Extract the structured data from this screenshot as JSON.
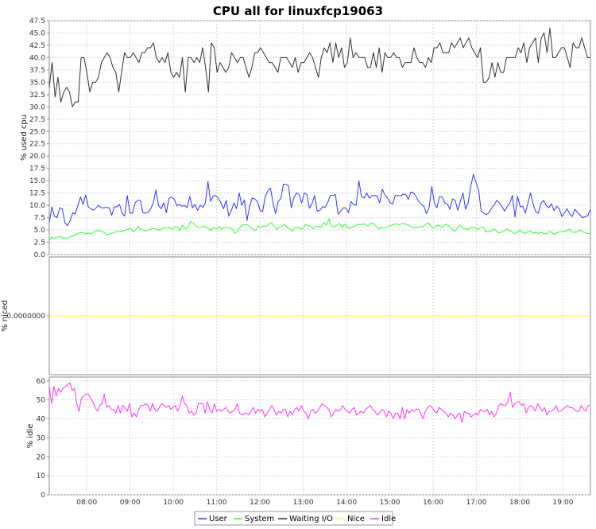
{
  "chart_data": {
    "type": "line",
    "title": "CPU all for linuxfcp19063",
    "x_tick_labels": [
      "08:00",
      "09:00",
      "10:00",
      "11:00",
      "12:00",
      "13:00",
      "14:00",
      "15:00",
      "16:00",
      "17:00",
      "18:00",
      "19:00"
    ],
    "x_range": [
      "07:08",
      "19:38"
    ],
    "grid": true,
    "legend_position": "bottom",
    "legend": [
      "User",
      "System",
      "Waiting I/O",
      "Nice",
      "Idle"
    ],
    "colors": {
      "User": "#3333ff",
      "System": "#33ff33",
      "Waiting I/O": "#333333",
      "Nice": "#ffff33",
      "Idle": "#ff33ff"
    },
    "panels": [
      {
        "ylabel": "% used cpu",
        "ylim": [
          0,
          47.5
        ],
        "y_ticks": [
          "0.0",
          "2.5",
          "5.0",
          "7.5",
          "10.0",
          "12.5",
          "15.0",
          "17.5",
          "20.0",
          "22.5",
          "25.0",
          "27.5",
          "30.0",
          "32.5",
          "35.0",
          "37.5",
          "40.0",
          "42.5",
          "45.0",
          "47.5"
        ],
        "series": [
          {
            "name": "Waiting I/O",
            "values": [
              34,
              39,
              32,
              36,
              31,
              33,
              34,
              33,
              30,
              31,
              31,
              40,
              40,
              37,
              33,
              35,
              35,
              36,
              39,
              40,
              41,
              40,
              38,
              37,
              33,
              37,
              41,
              40,
              40,
              41,
              40,
              39,
              41,
              41,
              42,
              42,
              43,
              40,
              39,
              40,
              39,
              41,
              37,
              36,
              37,
              36,
              40,
              33,
              40,
              40,
              39,
              40,
              39,
              42,
              38,
              33,
              43,
              42,
              37,
              39,
              38,
              37,
              38,
              41,
              40,
              39,
              40,
              40,
              38,
              36,
              38,
              41,
              41,
              42,
              41,
              40,
              39,
              39,
              38,
              37,
              40,
              40,
              40,
              39,
              38,
              40,
              37,
              39,
              39,
              40,
              41,
              40,
              38,
              36,
              40,
              42,
              41,
              43,
              39,
              43,
              40,
              42,
              38,
              39,
              44,
              40,
              41,
              40,
              40,
              40,
              38,
              38,
              41,
              38,
              42,
              37,
              41,
              40,
              40,
              41,
              40,
              40,
              38,
              39,
              39,
              39,
              42,
              40,
              39,
              39,
              38,
              40,
              39,
              42,
              42,
              43,
              41,
              41,
              41,
              43,
              42,
              43,
              44,
              42,
              43,
              44,
              42,
              41,
              40,
              42,
              35,
              35,
              36,
              39,
              36,
              39,
              37,
              37,
              40,
              40,
              40,
              40,
              42,
              41,
              43,
              39,
              42,
              43,
              44,
              39,
              44,
              45,
              41,
              46,
              40,
              40,
              41,
              42,
              42,
              40,
              38,
              43,
              42,
              42,
              44,
              42,
              40,
              40
            ]
          },
          {
            "name": "User",
            "values": [
              6.5,
              9.7,
              7.8,
              7.5,
              9.5,
              9.3,
              6.5,
              5.9,
              6.8,
              8.5,
              8.2,
              10,
              11.7,
              10.2,
              12.1,
              9.7,
              9.3,
              9,
              9.5,
              10,
              9.5,
              9.5,
              9.6,
              9.5,
              8,
              9.7,
              9.7,
              10.2,
              8.4,
              7.8,
              12,
              8.4,
              8.4,
              10.5,
              11,
              11,
              8.5,
              8.4,
              8.6,
              9.3,
              10.5,
              13.1,
              10,
              9.3,
              10.5,
              8.5,
              11.4,
              11.7,
              11.3,
              9.9,
              10.2,
              9.8,
              10,
              9.5,
              11.8,
              9.5,
              10.2,
              9,
              10,
              9.6,
              10.5,
              14.8,
              10.8,
              11.9,
              12,
              11.4,
              10.5,
              9.3,
              11,
              7.8,
              9,
              10.5,
              9.3,
              12.5,
              10,
              11.1,
              6.9,
              9.8,
              11.5,
              11.3,
              10.8,
              9,
              8.7,
              11.8,
              12.9,
              13.5,
              10.5,
              8.3,
              10.8,
              11.4,
              14.3,
              14.3,
              13.9,
              9.5,
              11.5,
              12.5,
              12.2,
              10.5,
              12.5,
              12.2,
              9.4,
              10.4,
              12,
              8.8,
              9,
              9.7,
              9.6,
              10.5,
              12,
              12,
              12.2,
              8.2,
              8.8,
              9.5,
              9.5,
              8.5,
              10.8,
              10.1,
              10,
              15,
              11.8,
              11.5,
              12.5,
              11.5,
              11.9,
              12,
              11.9,
              10.5,
              13.3,
              12.1,
              11.5,
              10.5,
              10.3,
              12,
              12,
              11.9,
              12.3,
              12.2,
              11.2,
              12.7,
              12.5,
              11.8,
              10.8,
              10.2,
              9.8,
              8.3,
              9.5,
              13.8,
              10.5,
              9.5,
              11.8,
              11.7,
              10.5,
              10.3,
              9.2,
              11.3,
              11,
              9,
              10.8,
              12.5,
              9.2,
              10.5,
              13.8,
              16.3,
              14.7,
              13.2,
              8.8,
              8.4,
              8.1,
              8.5,
              9.4,
              10.1,
              11,
              10.5,
              9.8,
              8.8,
              9.7,
              10.4,
              12,
              7.6,
              11.8,
              9.7,
              9.8,
              8.4,
              10.5,
              12.5,
              10.2,
              8.7,
              8.4,
              10.4,
              11,
              10,
              9.5,
              10.3,
              8.9,
              9.8,
              9.3,
              7.7,
              8.5,
              9.3,
              8.3,
              7.7,
              9.2,
              8.6,
              8,
              7.5,
              7.7,
              7.9,
              9.2
            ]
          },
          {
            "name": "System",
            "values": [
              3,
              3.5,
              3.2,
              3.5,
              3.7,
              3.4,
              3.4,
              3.3,
              3.6,
              3.7,
              4,
              4.3,
              4.5,
              4.4,
              4.2,
              4.4,
              4.2,
              4.5,
              4.8,
              4.9,
              4.7,
              4.5,
              4,
              4.2,
              4.3,
              4.5,
              4.7,
              4.6,
              4.8,
              4.9,
              5.1,
              5.4,
              4.6,
              5,
              5.8,
              5.1,
              5,
              4.8,
              5,
              5.2,
              5.3,
              5.1,
              5,
              5.2,
              5.5,
              5.4,
              5.5,
              5.1,
              5.7,
              5.6,
              4.9,
              6,
              5.2,
              5.5,
              6.7,
              6.4,
              5.9,
              5.5,
              5.5,
              5.8,
              5.5,
              5.2,
              5,
              5.5,
              5.2,
              5.7,
              5.1,
              5.5,
              5.5,
              5.5,
              5.2,
              4.3,
              4.8,
              5.6,
              6,
              6.1,
              6,
              5.5,
              5.1,
              4.9,
              5.8,
              5.5,
              5.8,
              5.7,
              6.2,
              6.5,
              5.8,
              5.1,
              5.6,
              5.7,
              6.1,
              5.5,
              5.2,
              4.8,
              5.5,
              5.6,
              5.2,
              5.2,
              6.1,
              5.9,
              5.8,
              5.2,
              5.8,
              5.7,
              5.5,
              6.5,
              6,
              7.3,
              5.7,
              5.6,
              6,
              6.3,
              5.5,
              6.2,
              5.5,
              5.3,
              5.6,
              5.8,
              6.1,
              6.1,
              6.2,
              6.1,
              5.8,
              6.5,
              6.3,
              5.8,
              5.2,
              5.5,
              5.4,
              5.5,
              5.8,
              6,
              6.2,
              6.2,
              6,
              6.4,
              6.2,
              6.1,
              5.8,
              5.5,
              5.5,
              5.5,
              5.7,
              5.6,
              6.2,
              6.5,
              5.7,
              5.4,
              5.8,
              6,
              5.5,
              5.9,
              6.2,
              5.7,
              5.2,
              4.7,
              5.3,
              6,
              5.5,
              5.2,
              5.1,
              5.4,
              5.6,
              5.4,
              5.1,
              5.5,
              5.6,
              4.6,
              4.6,
              4.7,
              5.2,
              4.8,
              4.4,
              4.6,
              4.8,
              5.2,
              4.9,
              4.6,
              4.2,
              4.5,
              5,
              4.5,
              4.3,
              4.6,
              4.8,
              4.4,
              4.5,
              4.3,
              4.5,
              4.3,
              4.2,
              4.6,
              4.6,
              4.1,
              4.4,
              4.6,
              4.6,
              4.6,
              4.9,
              5.2,
              4.6,
              4.5,
              4.6,
              5,
              4.7,
              4.4,
              4.3,
              4.3
            ]
          }
        ]
      },
      {
        "ylabel": "% niced",
        "y_ticks": [
          "0.0000000"
        ],
        "series": [
          {
            "name": "Nice",
            "values": [
              0,
              0
            ]
          }
        ]
      },
      {
        "ylabel": "% idle",
        "ylim": [
          0,
          62
        ],
        "y_ticks": [
          "0",
          "10",
          "20",
          "30",
          "40",
          "50",
          "60"
        ],
        "series": [
          {
            "name": "Idle",
            "values": [
              57,
              48,
              57,
              52,
              56,
              54,
              56,
              57,
              58,
              59,
              55,
              56,
              48,
              44,
              51,
              52,
              53,
              53,
              51,
              49,
              46,
              44,
              47,
              48,
              53,
              46,
              47,
              45,
              45,
              43,
              47,
              43,
              47,
              46,
              44,
              48,
              41,
              43,
              41,
              45,
              47,
              47,
              48,
              47,
              44,
              48,
              45,
              44,
              46,
              48,
              47,
              46,
              47,
              45,
              46,
              47,
              44,
              47,
              52,
              48,
              47,
              43,
              44,
              42,
              43,
              48,
              48,
              48,
              43,
              49,
              45,
              43,
              48,
              44,
              45,
              44,
              45,
              46,
              44,
              43,
              44,
              45,
              48,
              43,
              42,
              43,
              43,
              42,
              44,
              46,
              43,
              45,
              44,
              45,
              41,
              43,
              45,
              47,
              45,
              42,
              44,
              43,
              45,
              45,
              41,
              44,
              42,
              45,
              46,
              44,
              47,
              44,
              43,
              40,
              44,
              45,
              43,
              44,
              46,
              48,
              47,
              46,
              45,
              41,
              43,
              45,
              44,
              45,
              47,
              45,
              44,
              43,
              45,
              46,
              42,
              43,
              44,
              43,
              45,
              46,
              47,
              45,
              44,
              42,
              43,
              45,
              44,
              41,
              44,
              43,
              40,
              43,
              43,
              40,
              46,
              40,
              45,
              43,
              45,
              44,
              45,
              45,
              43,
              40,
              44,
              46,
              47,
              46,
              44,
              43,
              46,
              45,
              44,
              43,
              41,
              43,
              42,
              40,
              42,
              43,
              38,
              44,
              43,
              43,
              41,
              42,
              43,
              42,
              45,
              44,
              44,
              45,
              42,
              44,
              41,
              43,
              47,
              48,
              47,
              47,
              49,
              54,
              46,
              48,
              49,
              49,
              47,
              48,
              43,
              46,
              47,
              46,
              44,
              48,
              46,
              44,
              46,
              42,
              44,
              44,
              45,
              47,
              44,
              44,
              45,
              46,
              47,
              46,
              46,
              45,
              44,
              44,
              47,
              45,
              44,
              47,
              47
            ]
          }
        ]
      }
    ]
  }
}
